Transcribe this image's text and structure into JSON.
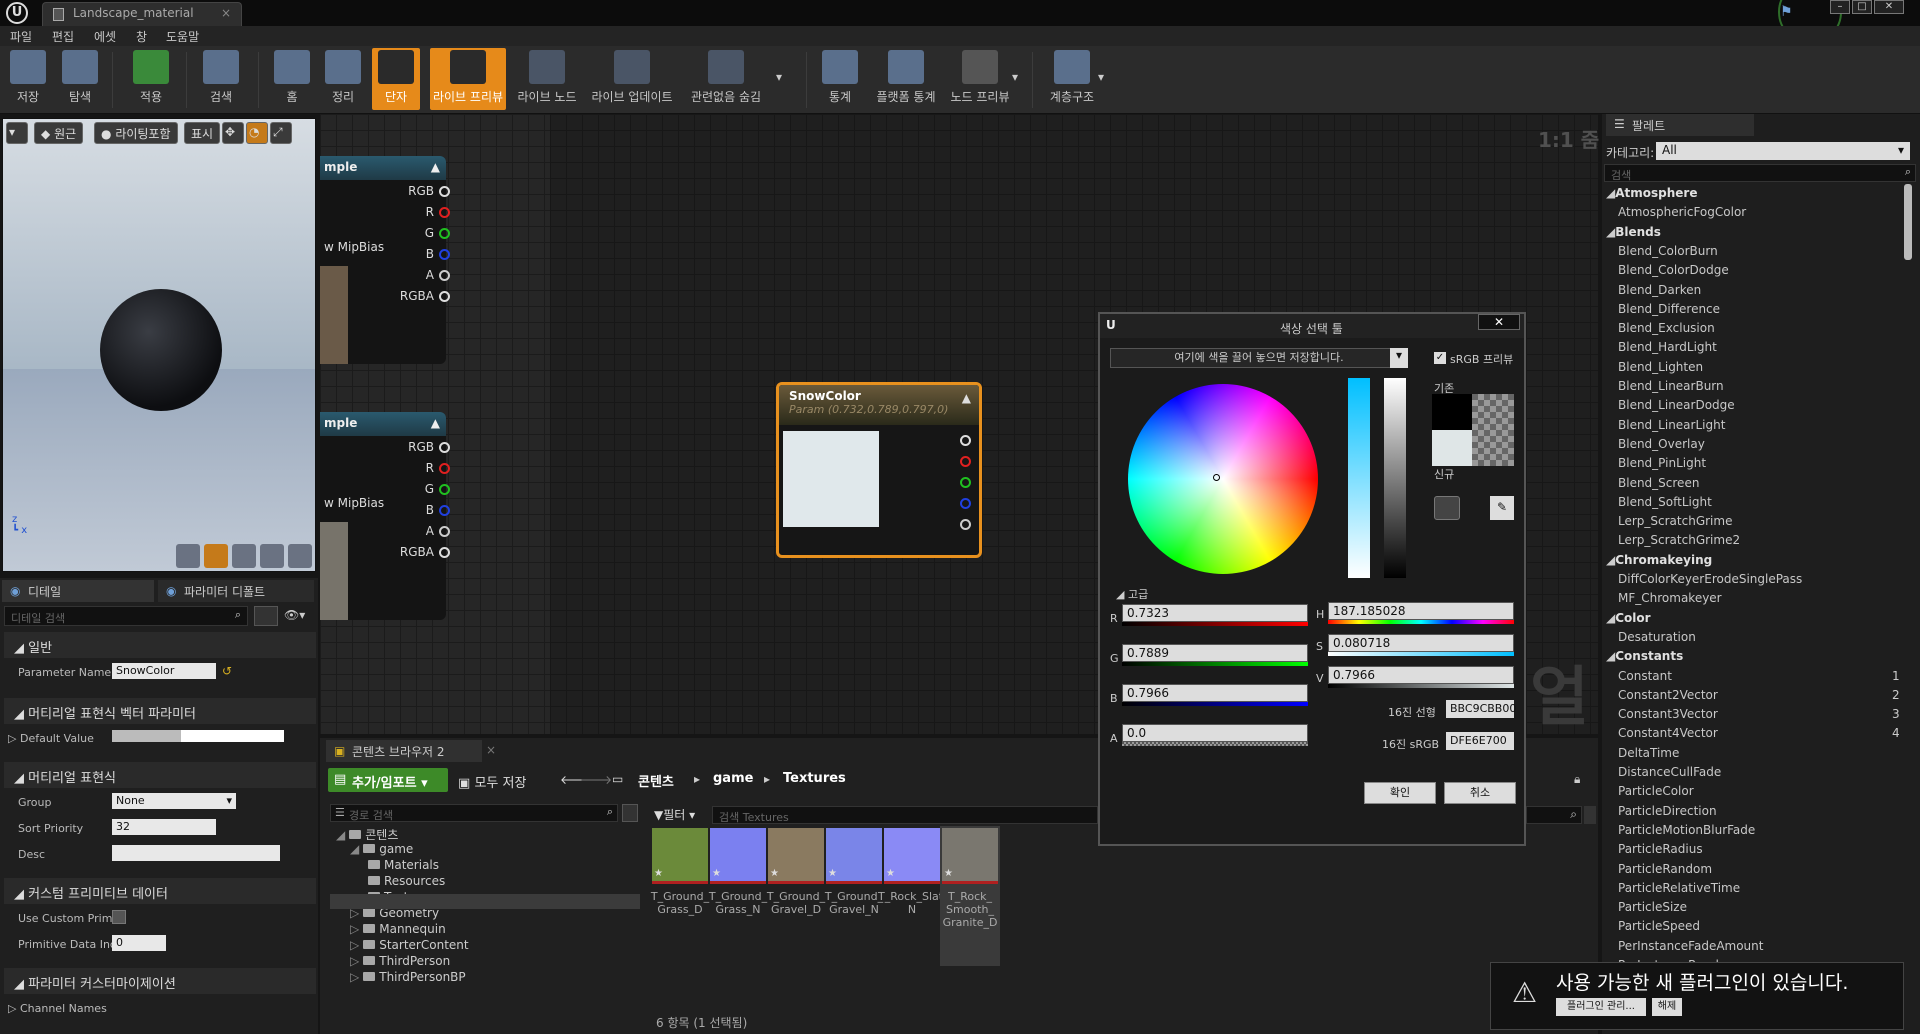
{
  "window": {
    "tab_title": "Landscape_material"
  },
  "menu": [
    "파일",
    "편집",
    "에셋",
    "창",
    "도움말"
  ],
  "toolbar": [
    {
      "label": "저장",
      "icon": "save-icon"
    },
    {
      "label": "탐색",
      "icon": "browse-icon"
    },
    {
      "label": "적용",
      "icon": "apply-icon"
    },
    {
      "label": "검색",
      "icon": "search-icon"
    },
    {
      "label": "홈",
      "icon": "home-icon"
    },
    {
      "label": "정리",
      "icon": "clean-icon"
    },
    {
      "label": "단자",
      "icon": "connectors-icon"
    },
    {
      "label": "라이브 프리뷰",
      "icon": "live-preview-icon"
    },
    {
      "label": "라이브 노드",
      "icon": "live-nodes-icon"
    },
    {
      "label": "라이브 업데이트",
      "icon": "live-update-icon"
    },
    {
      "label": "관련없음 숨김",
      "icon": "hide-unrelated-icon"
    },
    {
      "label": "통계",
      "icon": "stats-icon"
    },
    {
      "label": "플랫폼 통계",
      "icon": "platform-stats-icon"
    },
    {
      "label": "노드 프리뷰",
      "icon": "node-preview-icon"
    },
    {
      "label": "계층구조",
      "icon": "hierarchy-icon"
    }
  ],
  "viewport": {
    "buttons": [
      "원근",
      "라이팅포함",
      "표시"
    ]
  },
  "details": {
    "tabs": [
      "디테일",
      "파라미터 디폴트"
    ],
    "search_placeholder": "디테일 검색",
    "sections": {
      "general": "일반",
      "vector_param": "머티리얼 표현식 벡터 파라미터",
      "expression": "머티리얼 표현식",
      "custom_primitive": "커스텀 프리미티브 데이터",
      "param_custom": "파라미터 커스터마이제이션"
    },
    "param_name_label": "Parameter Name",
    "param_name_value": "SnowColor",
    "default_value_label": "Default Value",
    "group_label": "Group",
    "group_value": "None",
    "sort_priority_label": "Sort Priority",
    "sort_priority_value": "32",
    "desc_label": "Desc",
    "use_custom_prim_label": "Use Custom Prim",
    "primitive_index_label": "Primitive Data Inc",
    "primitive_index_value": "0",
    "channel_names_label": "Channel Names"
  },
  "graph": {
    "zoom": "1:1 줌",
    "texture_nodes": [
      {
        "title": "mple",
        "pins": [
          "RGB",
          "R",
          "G",
          "B",
          "A",
          "RGBA"
        ],
        "mip": "w MipBias"
      },
      {
        "title": "mple",
        "pins": [
          "RGB",
          "R",
          "G",
          "B",
          "A",
          "RGBA"
        ],
        "mip": "w MipBias"
      }
    ],
    "pin_colors": [
      "#dddddd",
      "#e02020",
      "#20c020",
      "#2040e0",
      "#cccccc",
      "#dddddd"
    ],
    "snow_node": {
      "title": "SnowColor",
      "subtitle": "Param (0.732,0.789,0.797,0)",
      "swatch": "#e0e8eb"
    },
    "watermark": "얼"
  },
  "content_browser": {
    "tab": "콘텐츠 브라우저 2",
    "add_import": "추가/임포트",
    "save_all": "모두 저장",
    "breadcrumb": [
      "콘텐츠",
      "game",
      "Textures"
    ],
    "path_search_placeholder": "경로 검색",
    "filter_label": "필터",
    "asset_search_placeholder": "검색 Textures",
    "tree": [
      {
        "label": "콘텐츠",
        "level": 0
      },
      {
        "label": "game",
        "level": 1
      },
      {
        "label": "Materials",
        "level": 2
      },
      {
        "label": "Resources",
        "level": 2
      },
      {
        "label": "Textures",
        "level": 2
      },
      {
        "label": "Geometry",
        "level": 1
      },
      {
        "label": "Mannequin",
        "level": 1
      },
      {
        "label": "StarterContent",
        "level": 1
      },
      {
        "label": "ThirdPerson",
        "level": 1
      },
      {
        "label": "ThirdPersonBP",
        "level": 1
      }
    ],
    "assets": [
      {
        "label": "T_Ground_\nGrass_D",
        "color": "#6b8a3a"
      },
      {
        "label": "T_Ground_\nGrass_N",
        "color": "#7b80f0"
      },
      {
        "label": "T_Ground_\nGravel_D",
        "color": "#8a7a60"
      },
      {
        "label": "T_Ground_\nGravel_N",
        "color": "#7a85e8"
      },
      {
        "label": "T_Rock_Slate_\nN",
        "color": "#8a8af5"
      },
      {
        "label": "T_Rock_\nSmooth_\nGranite_D",
        "color": "#7a776f"
      }
    ],
    "status": "6 항목 (1 선택됨)"
  },
  "palette": {
    "tab": "팔레트",
    "category_label": "카테고리:",
    "category_value": "All",
    "search_placeholder": "검색",
    "entries": [
      {
        "type": "cat",
        "label": "Atmosphere"
      },
      {
        "type": "item",
        "label": "AtmosphericFogColor"
      },
      {
        "type": "cat",
        "label": "Blends"
      },
      {
        "type": "item",
        "label": "Blend_ColorBurn"
      },
      {
        "type": "item",
        "label": "Blend_ColorDodge"
      },
      {
        "type": "item",
        "label": "Blend_Darken"
      },
      {
        "type": "item",
        "label": "Blend_Difference"
      },
      {
        "type": "item",
        "label": "Blend_Exclusion"
      },
      {
        "type": "item",
        "label": "Blend_HardLight"
      },
      {
        "type": "item",
        "label": "Blend_Lighten"
      },
      {
        "type": "item",
        "label": "Blend_LinearBurn"
      },
      {
        "type": "item",
        "label": "Blend_LinearDodge"
      },
      {
        "type": "item",
        "label": "Blend_LinearLight"
      },
      {
        "type": "item",
        "label": "Blend_Overlay"
      },
      {
        "type": "item",
        "label": "Blend_PinLight"
      },
      {
        "type": "item",
        "label": "Blend_Screen"
      },
      {
        "type": "item",
        "label": "Blend_SoftLight"
      },
      {
        "type": "item",
        "label": "Lerp_ScratchGrime"
      },
      {
        "type": "item",
        "label": "Lerp_ScratchGrime2"
      },
      {
        "type": "cat",
        "label": "Chromakeying"
      },
      {
        "type": "item",
        "label": "DiffColorKeyerErodeSinglePass"
      },
      {
        "type": "item",
        "label": "MF_Chromakeyer"
      },
      {
        "type": "cat",
        "label": "Color"
      },
      {
        "type": "item",
        "label": "Desaturation"
      },
      {
        "type": "cat",
        "label": "Constants"
      },
      {
        "type": "item",
        "label": "Constant",
        "key": "1"
      },
      {
        "type": "item",
        "label": "Constant2Vector",
        "key": "2"
      },
      {
        "type": "item",
        "label": "Constant3Vector",
        "key": "3"
      },
      {
        "type": "item",
        "label": "Constant4Vector",
        "key": "4"
      },
      {
        "type": "item",
        "label": "DeltaTime"
      },
      {
        "type": "item",
        "label": "DistanceCullFade"
      },
      {
        "type": "item",
        "label": "ParticleColor"
      },
      {
        "type": "item",
        "label": "ParticleDirection"
      },
      {
        "type": "item",
        "label": "ParticleMotionBlurFade"
      },
      {
        "type": "item",
        "label": "ParticleRadius"
      },
      {
        "type": "item",
        "label": "ParticleRandom"
      },
      {
        "type": "item",
        "label": "ParticleRelativeTime"
      },
      {
        "type": "item",
        "label": "ParticleSize"
      },
      {
        "type": "item",
        "label": "ParticleSpeed"
      },
      {
        "type": "item",
        "label": "PerInstanceFadeAmount"
      },
      {
        "type": "item",
        "label": "PerInstanceRandom"
      }
    ]
  },
  "color_picker": {
    "title": "색상 선택 툴",
    "drop_hint": "여기에 색을 끌어 놓으면 저장합니다.",
    "srgb_preview": "sRGB 프리뷰",
    "old_label": "기존",
    "new_label": "신규",
    "advanced": "고급",
    "r": "0.7323",
    "g": "0.7889",
    "b": "0.7966",
    "a": "0.0",
    "h": "187.185028",
    "s": "0.080718",
    "v": "0.7966",
    "hex_linear_label": "16진 선형",
    "hex_linear": "BBC9CBB00",
    "hex_srgb_label": "16진 sRGB",
    "hex_srgb": "DFE6E700",
    "ok": "확인",
    "cancel": "취소",
    "new_color": "#dfe6e7"
  },
  "notification": {
    "message": "사용 가능한 새 플러그인이 있습니다.",
    "manage": "플러그인 관리...",
    "dismiss": "해제"
  }
}
